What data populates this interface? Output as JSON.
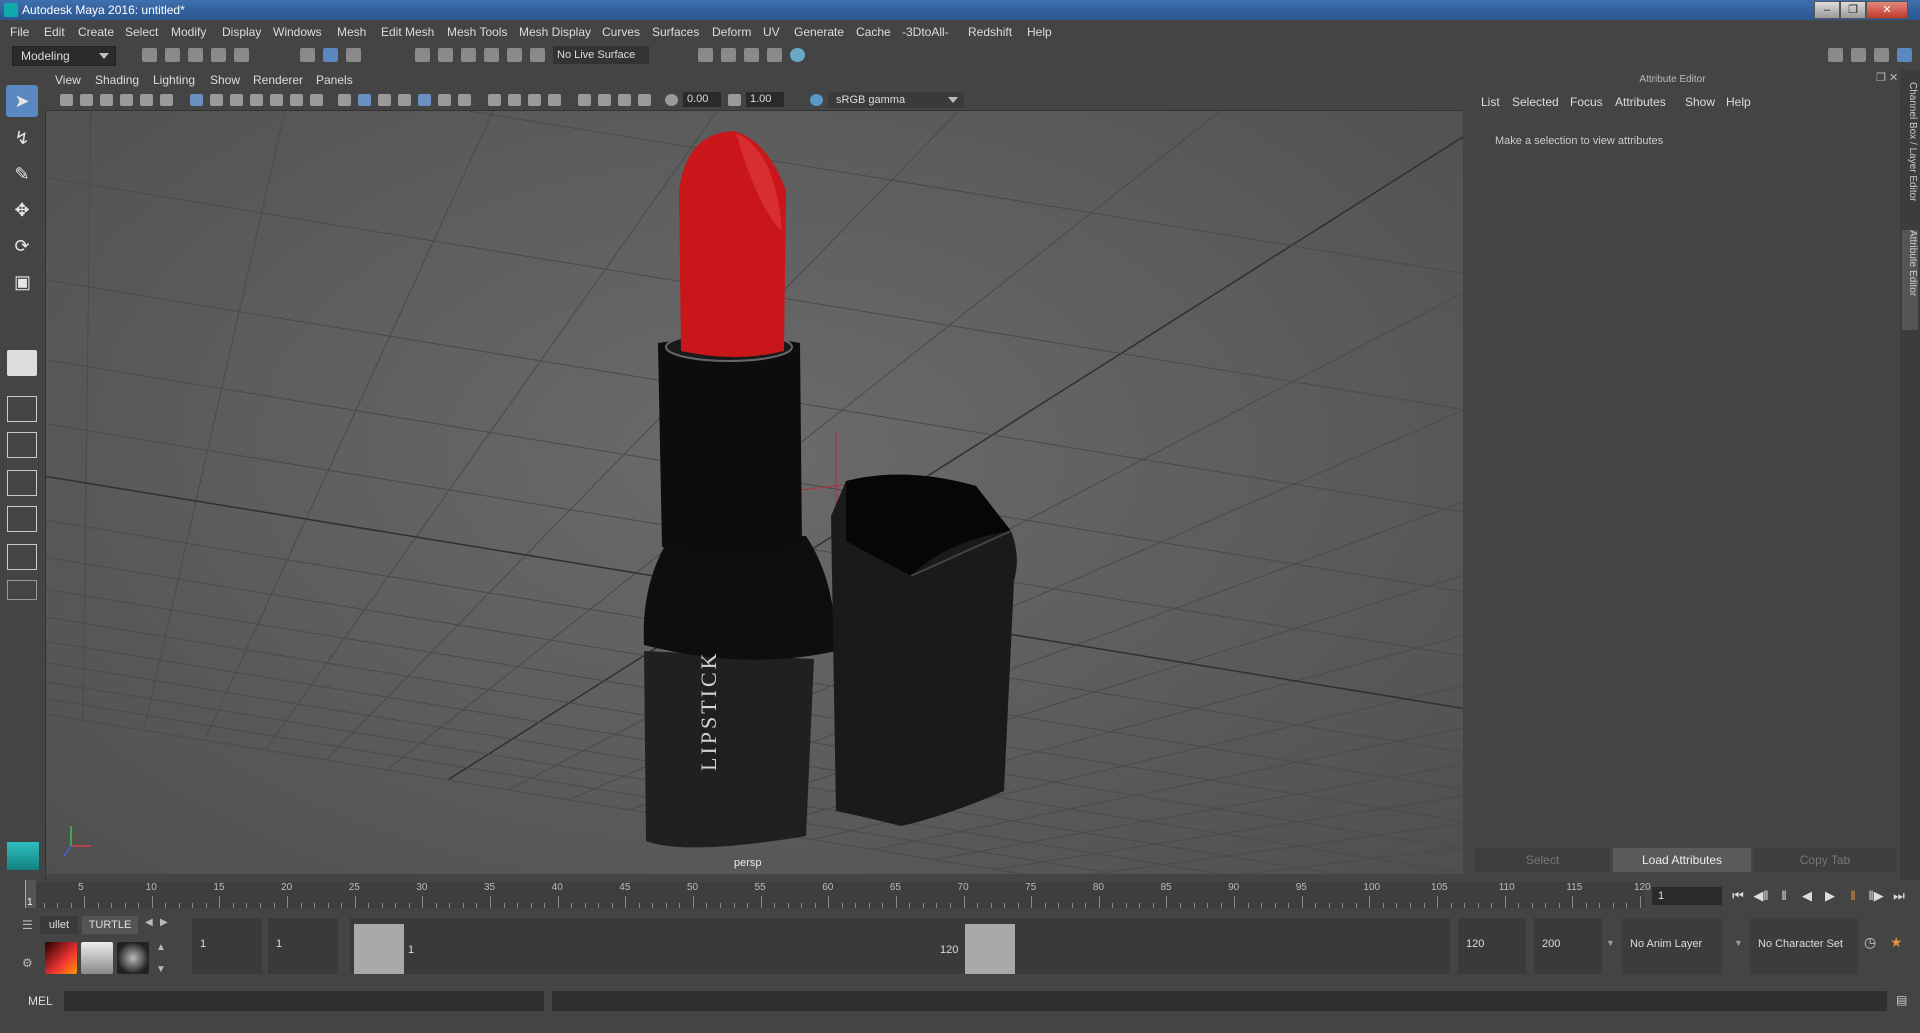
{
  "window": {
    "title": "Autodesk Maya 2016: untitled*",
    "controls": [
      "minimize-icon",
      "restore-icon",
      "close-icon"
    ]
  },
  "menubar": [
    "File",
    "Edit",
    "Create",
    "Select",
    "Modify",
    "Display",
    "Windows",
    "Mesh",
    "Edit Mesh",
    "Mesh Tools",
    "Mesh Display",
    "Curves",
    "Surfaces",
    "Deform",
    "UV",
    "Generate",
    "Cache",
    "-3DtoAll-",
    "Redshift",
    "Help"
  ],
  "statusline": {
    "menuset": "Modeling",
    "live_surface": "No Live Surface"
  },
  "viewport": {
    "menus": [
      "View",
      "Shading",
      "Lighting",
      "Show",
      "Renderer",
      "Panels"
    ],
    "exposure": "0.00",
    "gamma": "1.00",
    "color_space": "sRGB gamma",
    "camera_label": "persp",
    "model_text": "LIPSTICK",
    "colors": {
      "lipstick": "#c8161a",
      "case": "#151515",
      "grid": "#4a4a4a"
    }
  },
  "attribute_editor": {
    "title": "Attribute Editor",
    "menus": [
      "List",
      "Selected",
      "Focus",
      "Attributes",
      "Show",
      "Help"
    ],
    "message": "Make a selection to view attributes",
    "buttons": {
      "select": "Select",
      "load": "Load Attributes",
      "copy": "Copy Tab"
    }
  },
  "side_tabs": [
    "Channel Box / Layer Editor",
    "Attribute Editor"
  ],
  "timeline": {
    "ticks": [
      "5",
      "10",
      "15",
      "20",
      "25",
      "30",
      "35",
      "40",
      "45",
      "50",
      "55",
      "60",
      "65",
      "70",
      "75",
      "80",
      "85",
      "90",
      "95",
      "100",
      "105",
      "110",
      "115",
      "120"
    ],
    "start_mark": "1",
    "current_frame": "1"
  },
  "range": {
    "shelf_tabs": [
      "ullet",
      "TURTLE"
    ],
    "start": "1",
    "playback_start": "1",
    "handle_start": "1",
    "handle_end": "120",
    "playback_end": "120",
    "end": "200",
    "anim_layer": "No Anim Layer",
    "character_set": "No Character Set"
  },
  "command_line": {
    "label": "MEL"
  }
}
